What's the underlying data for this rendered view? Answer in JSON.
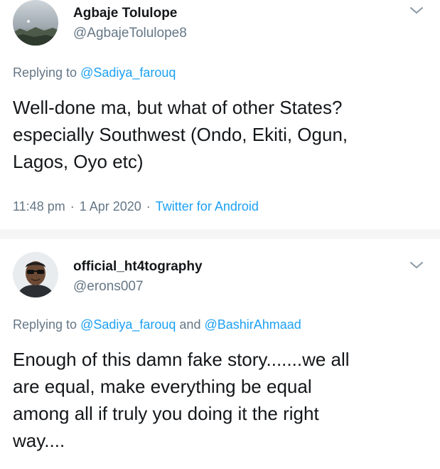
{
  "colors": {
    "text": "#14171a",
    "muted": "#657786",
    "link": "#1da1f2",
    "separator": "#f5f5f5"
  },
  "tweets": [
    {
      "author_name": "Agbaje Tolulope",
      "handle": "@AgbajeTolulope8",
      "replying_prefix": "Replying to ",
      "replying_mentions": [
        "@Sadiya_farouq"
      ],
      "replying_joiner": "",
      "text": "Well-done ma, but what of other States?\nespecially Southwest (Ondo, Ekiti, Ogun,\nLagos, Oyo etc)",
      "time": "11:48 pm",
      "dot": "·",
      "date": "1 Apr 2020",
      "source": "Twitter for Android",
      "avatar_icon": "sky-landscape-avatar",
      "menu_icon": "chevron-down-icon"
    },
    {
      "author_name": "official_ht4tography",
      "handle": "@erons007",
      "replying_prefix": "Replying to ",
      "replying_mentions": [
        "@Sadiya_farouq",
        "@BashirAhmaad"
      ],
      "replying_joiner": " and ",
      "text": "Enough of this damn fake story.......we all\nare equal, make everything be equal\namong all if truly you doing it the right\nway....",
      "avatar_icon": "person-with-sunglasses-avatar",
      "menu_icon": "chevron-down-icon"
    }
  ]
}
